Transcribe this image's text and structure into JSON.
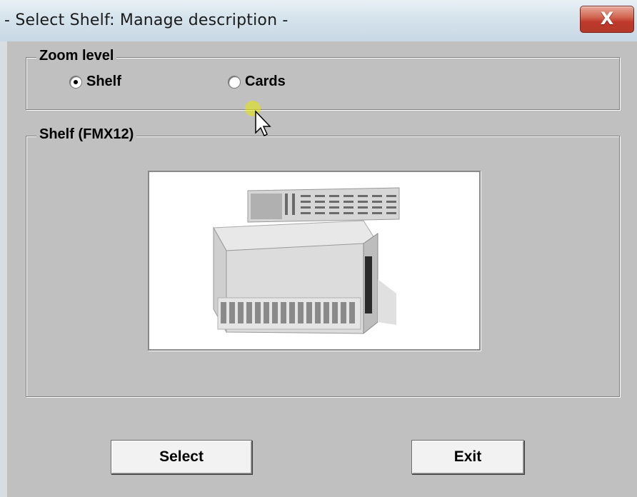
{
  "window": {
    "title": "- Select Shelf: Manage description -",
    "close_label": "X"
  },
  "zoom_level": {
    "legend": "Zoom level",
    "options": [
      {
        "label": "Shelf",
        "selected": true
      },
      {
        "label": "Cards",
        "selected": false
      }
    ]
  },
  "shelf": {
    "legend": "Shelf (FMX12)",
    "image_icon": "shelf-equipment-image"
  },
  "buttons": {
    "select_label": "Select",
    "exit_label": "Exit"
  },
  "colors": {
    "background": "#c0c0c0",
    "close_button": "#c0392b"
  }
}
